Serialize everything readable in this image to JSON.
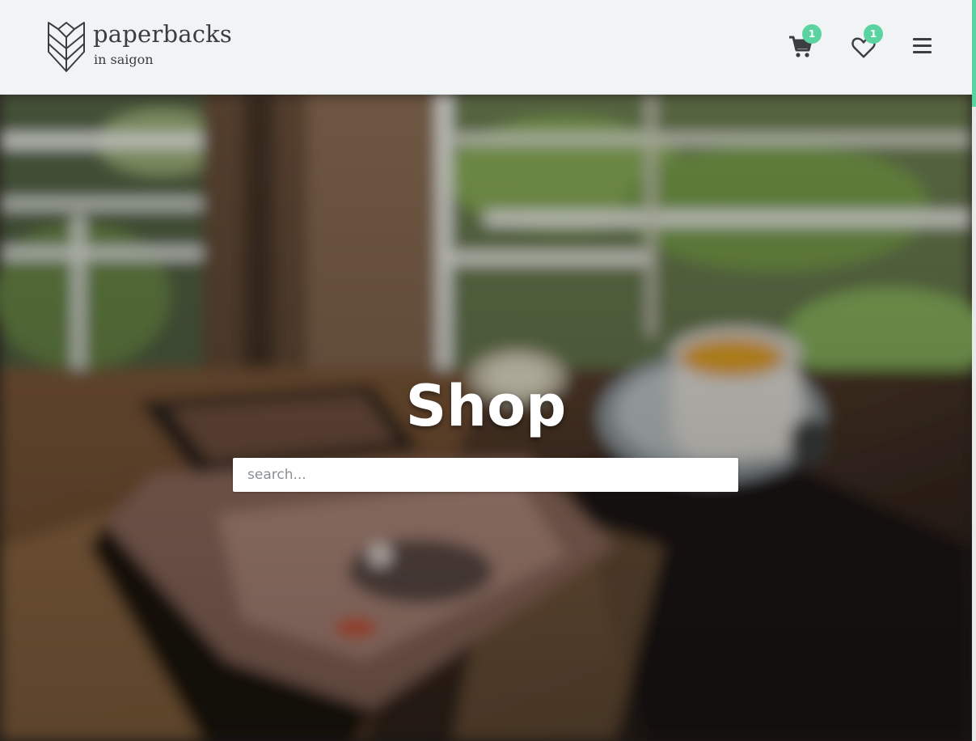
{
  "brand": {
    "name": "paperbacks",
    "tagline": "in saigon"
  },
  "header": {
    "cart": {
      "icon": "cart-icon",
      "count": "1"
    },
    "wishlist": {
      "icon": "heart-icon",
      "count": "1"
    },
    "menu": {
      "icon": "hamburger-menu-icon"
    }
  },
  "hero": {
    "title": "Shop",
    "search_placeholder": "search..."
  },
  "colors": {
    "accent": "#5ad3a0",
    "header_bg": "#f1f4f5",
    "icon": "#3a3d41"
  }
}
